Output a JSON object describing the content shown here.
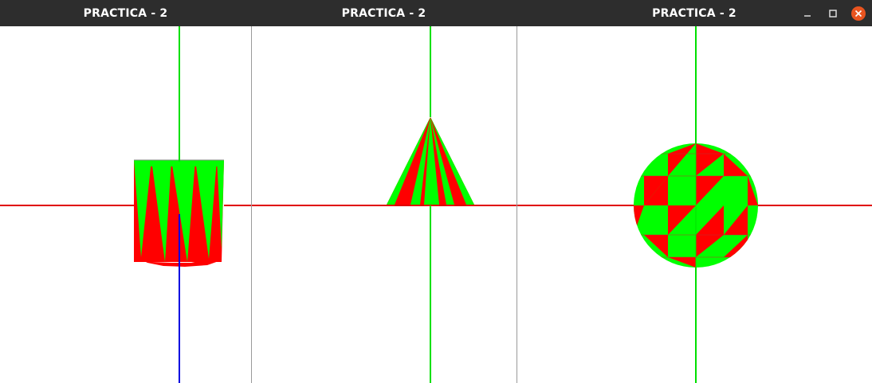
{
  "windows": [
    {
      "title": "PRACTICA - 2",
      "shape": "cylinder"
    },
    {
      "title": "PRACTICA - 2",
      "shape": "cone"
    },
    {
      "title": "PRACTICA - 2",
      "shape": "sphere"
    }
  ],
  "window_controls": [
    "minimize-icon",
    "maximize-icon",
    "close-icon"
  ],
  "colors": {
    "titlebar": "#2d2d2d",
    "axis_x": "#e00000",
    "axis_y": "#00e000",
    "axis_z": "#0000e0",
    "face_a": "#ff0000",
    "face_b": "#00ff00",
    "close_button": "#e9541f"
  }
}
